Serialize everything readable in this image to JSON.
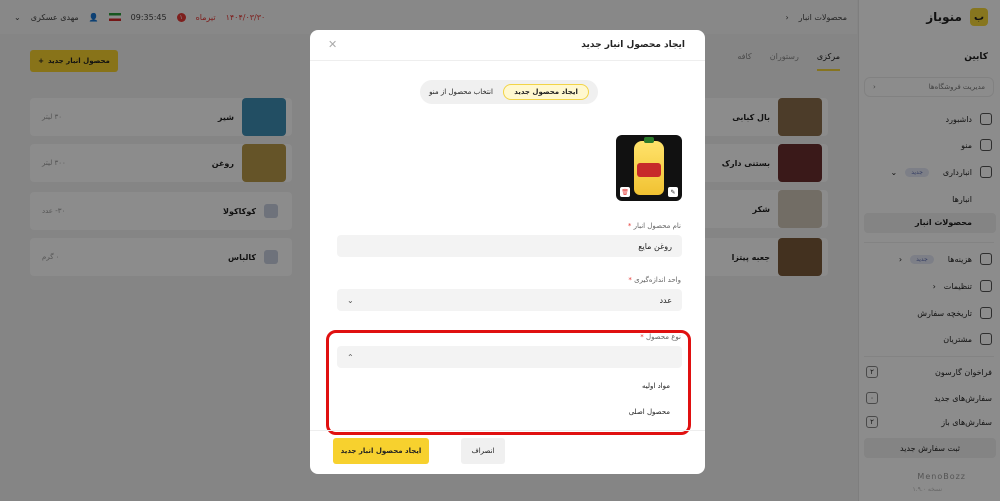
{
  "app": {
    "brand": "منوباز",
    "cabin": "کابین",
    "store_manage": "مدیریت فروشگاه‌ها"
  },
  "sidebar": {
    "dashboard": "داشبورد",
    "menu": "منو",
    "inventory": "انبارداری",
    "new_badge": "جدید",
    "warehouses": "انبارها",
    "warehouse_products": "محصولات انبار",
    "costs": "هزینه‌ها",
    "settings": "تنظیمات",
    "order_history": "تاریخچه سفارش",
    "customers": "مشتریان",
    "waiter_call": {
      "label": "فراخوان گارسون",
      "count": "۲"
    },
    "new_orders": {
      "label": "سفارش‌های جدید",
      "count": "۰"
    },
    "open_orders": {
      "label": "سفارش‌های باز",
      "count": "۲"
    },
    "submit_new_order": "ثبت سفارش جدید",
    "footer_brand": "MenoBozz",
    "footer_version": "نسخه ۱.۹.۰"
  },
  "topbar": {
    "breadcrumb": "محصولات انبار",
    "date": "۱۴۰۴/۰۳/۳۰",
    "month_word": "تیرماه",
    "notification_count": "۱",
    "time": "09:35:45",
    "user_name": "مهدی عسکری"
  },
  "tabs": [
    "مرکزی",
    "رستوران",
    "کافه"
  ],
  "new_product_button": "محصول انبار جدید",
  "cards": [
    {
      "name": "بال کبابی",
      "qty": ""
    },
    {
      "name": "شیر",
      "qty": "۳۰ لیتر"
    },
    {
      "name": "بستنی دارک",
      "qty": ""
    },
    {
      "name": "روغن",
      "qty": "۳۰۰ لیتر"
    },
    {
      "name": "شکر",
      "qty": ""
    },
    {
      "name": "کوکاکولا",
      "qty": "۳۰- عدد"
    },
    {
      "name": "جعبه پیتزا",
      "qty": ""
    },
    {
      "name": "کالباس",
      "qty": "۰ گرم"
    }
  ],
  "modal": {
    "title": "ایجاد محصول انبار جدید",
    "toggle": {
      "from_menu": "انتخاب محصول از منو",
      "create_new": "ایجاد محصول جدید"
    },
    "name_label": "نام محصول انبار",
    "name_value": "روغن مایع",
    "unit_label": "واحد اندازه‌گیری",
    "unit_value": "عدد",
    "type_label": "نوع محصول",
    "type_options": [
      "مواد اولیه",
      "محصول اصلی"
    ],
    "create_button": "ایجاد محصول انبار جدید",
    "cancel_button": "انصراف"
  },
  "colors": {
    "accent": "#f7d12e",
    "highlight": "#e01010"
  }
}
